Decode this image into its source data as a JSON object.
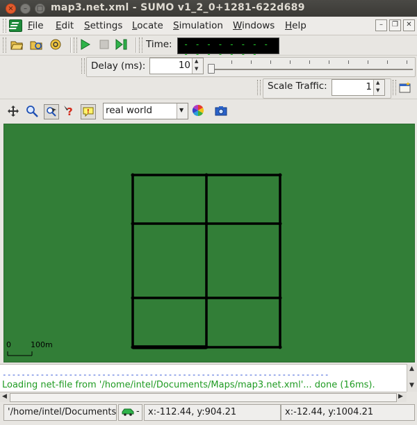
{
  "window": {
    "title": "map3.net.xml - SUMO v1_2_0+1281-622d689",
    "close_glyph": "×",
    "minimize_glyph": "–",
    "maximize_glyph": "□"
  },
  "menu": {
    "items": [
      {
        "label": "File",
        "mnemonic": "F",
        "rest": "ile"
      },
      {
        "label": "Edit",
        "mnemonic": "E",
        "rest": "dit"
      },
      {
        "label": "Settings",
        "mnemonic": "S",
        "rest": "ettings"
      },
      {
        "label": "Locate",
        "mnemonic": "L",
        "rest": "ocate"
      },
      {
        "label": "Simulation",
        "mnemonic": "S",
        "rest": "imulation"
      },
      {
        "label": "Windows",
        "mnemonic": "W",
        "rest": "indows"
      },
      {
        "label": "Help",
        "mnemonic": "H",
        "rest": "elp"
      }
    ],
    "win_controls": {
      "minimize": "–",
      "restore": "❐",
      "close": "✕"
    }
  },
  "toolbar": {
    "time_label": "Time:",
    "time_value": "- - - - - - - - - - - - - - -",
    "delay_label": "Delay (ms):",
    "delay_value": "10",
    "scale_label": "Scale Traffic:",
    "scale_value": "1"
  },
  "view_toolbar": {
    "color_scheme": "real world"
  },
  "map": {
    "scale_zero": "0",
    "scale_label": "100m",
    "background_color": "#327e37",
    "road_color": "#000000"
  },
  "messages": {
    "separator": "---------------------------------------------------------------------",
    "log_line": "Loading net-file from '/home/intel/Documents/Maps/map3.net.xml'... done (16ms).",
    "log_color": "#1f9b22"
  },
  "status": {
    "path": "'/home/intel/Documents/",
    "coord_gui": "x:-112.44, y:904.21",
    "coord_geo": "x:-12.44, y:1004.21"
  },
  "icons": [
    "app-icon",
    "open-icon",
    "reload-icon",
    "recent-icon",
    "play-icon",
    "stop-icon",
    "step-icon",
    "new-view-icon",
    "recenter-icon",
    "zoom-icon",
    "locator-icon",
    "help-icon",
    "tooltip-icon",
    "color-wheel-icon",
    "screenshot-icon",
    "car-icon"
  ]
}
